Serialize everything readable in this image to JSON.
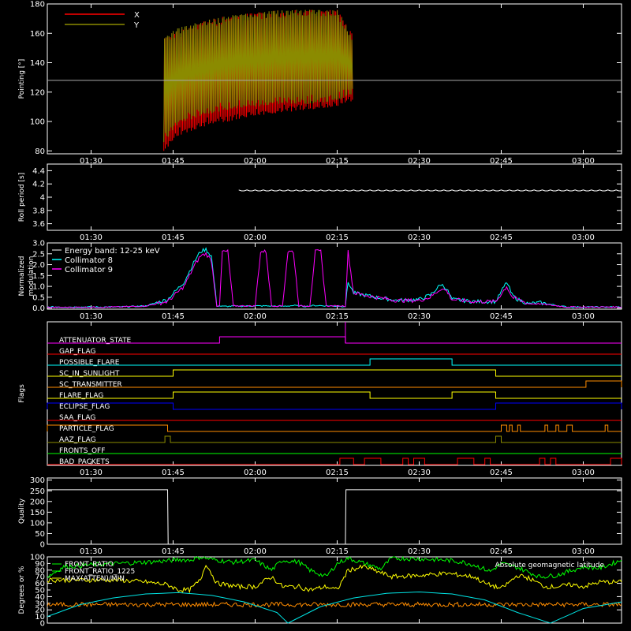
{
  "time_axis": {
    "ticks": [
      "01:30",
      "01:45",
      "02:00",
      "02:15",
      "02:30",
      "02:45",
      "03:00"
    ],
    "tick_values_min": [
      90,
      105,
      120,
      135,
      150,
      165,
      180
    ],
    "range_min": [
      82,
      187
    ]
  },
  "colors": {
    "x": "#ff0000",
    "y": "#8b8b00",
    "cyan": "#00ffff",
    "magenta": "#ff00ff",
    "yellow": "#ffff00",
    "green": "#00ff00",
    "orange": "#ff8c00",
    "red": "#ff0000",
    "blue": "#0000ff",
    "pink": "#ff1493"
  },
  "chart_data": [
    {
      "id": "pointing",
      "type": "line",
      "ylabel": "Pointing [°]",
      "ylim": [
        78,
        180
      ],
      "yticks": [
        80,
        100,
        120,
        140,
        160,
        180
      ],
      "legend": [
        "X",
        "Y"
      ],
      "series": [
        {
          "name": "X",
          "color": "#ff0000",
          "segments": [
            {
              "x": [
                103.3,
                106,
                110,
                115,
                120,
                125,
                130,
                135,
                137.8
              ],
              "lo": [
                80,
                90,
                96,
                100,
                104,
                106,
                108,
                110,
                114
              ],
              "hi": [
                158,
                162,
                168,
                172,
                174,
                176,
                176,
                176,
                160
              ]
            }
          ]
        },
        {
          "name": "Y",
          "color": "#8b8b00",
          "segments": [
            {
              "x": [
                103.3,
                106,
                110,
                115,
                120,
                125,
                130,
                135,
                137.8
              ],
              "lo": [
                86,
                98,
                104,
                108,
                110,
                112,
                112,
                114,
                118
              ],
              "hi": [
                158,
                164,
                168,
                172,
                174,
                176,
                176,
                176,
                158
              ]
            }
          ]
        }
      ],
      "reference_line": 128
    },
    {
      "id": "roll",
      "type": "line",
      "ylabel": "Roll period [s]",
      "ylim": [
        3.5,
        4.5
      ],
      "yticks": [
        3.6,
        3.8,
        4.0,
        4.2,
        4.4
      ],
      "series": [
        {
          "name": "",
          "color": "#ffffff",
          "x": [
            82,
            187
          ],
          "y": [
            4.1,
            4.1
          ]
        }
      ]
    },
    {
      "id": "modulation",
      "type": "line",
      "ylabel": "Normalized modulation",
      "ylim": [
        -0.05,
        3.0
      ],
      "yticks": [
        "0.0",
        "0.5",
        "1.0",
        "1.5",
        "2.0",
        "2.5",
        "3.0"
      ],
      "legend_title": "Energy band: 12-25 keV",
      "series": [
        {
          "name": "Collimator 8",
          "color": "#00ffff",
          "x": [
            82,
            95,
            100,
            104,
            107,
            109,
            110,
            111,
            112,
            113,
            113.5,
            114,
            120,
            121,
            122,
            125,
            126,
            127,
            129,
            130,
            131,
            136.5,
            137,
            138,
            142,
            146,
            150,
            152,
            154,
            155,
            156,
            160,
            164,
            166,
            167,
            168,
            170,
            172,
            177,
            187
          ],
          "y": [
            0.05,
            0.05,
            0.1,
            0.4,
            1.2,
            2.2,
            2.6,
            2.7,
            2.4,
            0.1,
            0.1,
            0.08,
            0.1,
            0.1,
            0.1,
            0.08,
            0.1,
            0.12,
            0.08,
            0.1,
            0.12,
            0.08,
            1.2,
            0.7,
            0.5,
            0.35,
            0.4,
            0.6,
            1.1,
            0.9,
            0.4,
            0.3,
            0.3,
            1.2,
            0.6,
            0.4,
            0.2,
            0.25,
            0.05,
            0.05
          ]
        },
        {
          "name": "Collimator 9",
          "color": "#ff00ff",
          "x": [
            82,
            95,
            100,
            104,
            107,
            109,
            110,
            111,
            112,
            113,
            113.5,
            114,
            115,
            116,
            117,
            118,
            120,
            121,
            122,
            123,
            124,
            125,
            126,
            127,
            128,
            129,
            130,
            131,
            132,
            133,
            134,
            135,
            136,
            136.5,
            137,
            138,
            142,
            146,
            150,
            152,
            154,
            155,
            156,
            160,
            164,
            166,
            167,
            168,
            170,
            172,
            177,
            187
          ],
          "y": [
            0.03,
            0.05,
            0.1,
            0.3,
            1.0,
            2.0,
            2.4,
            2.5,
            2.2,
            0.1,
            0.1,
            2.6,
            2.6,
            0.1,
            0.1,
            0.1,
            0.1,
            2.6,
            2.6,
            0.1,
            0.1,
            0.1,
            2.6,
            2.6,
            0.1,
            0.1,
            0.1,
            2.6,
            2.6,
            0.1,
            0.1,
            0.1,
            0.1,
            0.1,
            2.6,
            0.7,
            0.5,
            0.35,
            0.35,
            0.5,
            0.9,
            0.8,
            0.4,
            0.3,
            0.3,
            1.0,
            0.5,
            0.4,
            0.2,
            0.2,
            0.05,
            0.05
          ]
        }
      ]
    },
    {
      "id": "flags",
      "type": "step",
      "ylabel": "Flags",
      "flags": [
        {
          "name": "ATTENUATOR_STATE",
          "color": "#ff00ff",
          "on": [
            [
              113.5,
              136.5
            ]
          ],
          "spike": 136.5
        },
        {
          "name": "GAP_FLAG",
          "color": "#ff0000",
          "on": []
        },
        {
          "name": "POSSIBLE_FLARE",
          "color": "#00ffff",
          "on": [
            [
              141,
              156
            ]
          ]
        },
        {
          "name": "SC_IN_SUNLIGHT",
          "color": "#ffff00",
          "on": [
            [
              105,
              164
            ]
          ]
        },
        {
          "name": "SC_TRANSMITTER",
          "color": "#ff8c00",
          "on": [
            [
              180.5,
              187
            ]
          ]
        },
        {
          "name": "FLARE_FLAG",
          "color": "#ffff00",
          "on": [
            [
              105,
              141
            ],
            [
              156,
              164
            ]
          ]
        },
        {
          "name": "ECLIPSE_FLAG",
          "color": "#0000ff",
          "on": [
            [
              82,
              105
            ],
            [
              164,
              187
            ]
          ]
        },
        {
          "name": "SAA_FLAG",
          "color": "#ff0000",
          "on": []
        },
        {
          "name": "PARTICLE_FLAG",
          "color": "#ff8c00",
          "on": [
            [
              82,
              104
            ],
            [
              165,
              166
            ],
            [
              166.5,
              167
            ],
            [
              168,
              168.5
            ],
            [
              173,
              173.5
            ],
            [
              175,
              175.5
            ],
            [
              177,
              178
            ],
            [
              184,
              184.5
            ]
          ]
        },
        {
          "name": "AAZ_FLAG",
          "color": "#8b8b00",
          "on": [
            [
              103.5,
              104.5
            ],
            [
              164,
              165
            ]
          ]
        },
        {
          "name": "FRONTS_OFF",
          "color": "#00ff00",
          "on": []
        },
        {
          "name": "BAD_PACKETS",
          "color": "#ff0000",
          "on": [
            [
              135.5,
              138
            ],
            [
              140,
              143
            ],
            [
              147,
              148
            ],
            [
              149,
              151
            ],
            [
              157,
              160
            ],
            [
              162,
              163
            ],
            [
              172,
              173
            ],
            [
              174,
              175
            ],
            [
              185,
              187
            ]
          ]
        }
      ]
    },
    {
      "id": "quality",
      "type": "line",
      "ylabel": "Quality",
      "ylim": [
        0,
        310
      ],
      "yticks": [
        0,
        50,
        100,
        150,
        200,
        250,
        300
      ],
      "series": [
        {
          "name": "",
          "color": "#ffffff",
          "x": [
            82,
            104,
            104.1,
            136.5,
            136.6,
            187
          ],
          "y": [
            255,
            255,
            0,
            0,
            255,
            255
          ]
        }
      ]
    },
    {
      "id": "ratios",
      "type": "line",
      "ylabel": "Degrees or %",
      "ylim": [
        0,
        100
      ],
      "yticks": [
        0,
        10,
        20,
        30,
        40,
        50,
        60,
        70,
        80,
        90,
        100
      ],
      "legend": [
        "FRONT_RATIO",
        "FRONT_RATIO_1225",
        "MAX(ATTEN)/MIN",
        "Absolute geomagnetic latitude"
      ],
      "series": [
        {
          "name": "FRONT_RATIO",
          "color": "#00ff00",
          "x": [
            82,
            85,
            90,
            95,
            100,
            104,
            106,
            108,
            110,
            111,
            113,
            116,
            120,
            123,
            125,
            128,
            130,
            133,
            135,
            137,
            140,
            143,
            145,
            150,
            155,
            158,
            160,
            163,
            165,
            168,
            172,
            175,
            180,
            183,
            187
          ],
          "y": [
            70,
            85,
            88,
            90,
            92,
            94,
            96,
            95,
            100,
            98,
            95,
            92,
            95,
            80,
            95,
            92,
            80,
            70,
            90,
            98,
            90,
            82,
            98,
            97,
            95,
            92,
            88,
            78,
            90,
            84,
            70,
            72,
            85,
            83,
            95
          ]
        },
        {
          "name": "FRONT_RATIO_1225",
          "color": "#00ff00",
          "x": [
            82,
            187
          ],
          "y": [
            95,
            95
          ]
        },
        {
          "name": "MAX(ATTEN)/MIN",
          "color": "#ffff00",
          "x": [
            82,
            95,
            100,
            104,
            106,
            108,
            110,
            111,
            113,
            117,
            120,
            123,
            125,
            128,
            130,
            133,
            135,
            137,
            140,
            145,
            150,
            155,
            158,
            160,
            162,
            165,
            168,
            170,
            173,
            175,
            178,
            180,
            183,
            187
          ],
          "y": [
            65,
            65,
            62,
            58,
            50,
            50,
            65,
            90,
            60,
            55,
            55,
            70,
            55,
            55,
            50,
            55,
            50,
            80,
            85,
            70,
            72,
            75,
            72,
            70,
            60,
            52,
            72,
            68,
            55,
            55,
            58,
            55,
            62,
            62
          ]
        },
        {
          "name": "",
          "color": "#ff8c00",
          "x": [
            82,
            187
          ],
          "y": [
            28,
            28
          ]
        },
        {
          "name": "Absolute geomagnetic latitude",
          "color": "#00e5e5",
          "x": [
            82,
            88,
            94,
            100,
            106,
            112,
            118,
            124,
            126,
            132,
            138,
            144,
            150,
            156,
            162,
            168,
            174,
            180,
            187
          ],
          "y": [
            10,
            28,
            38,
            44,
            46,
            42,
            32,
            16,
            0,
            25,
            38,
            45,
            47,
            44,
            35,
            16,
            0,
            22,
            32
          ]
        }
      ]
    }
  ]
}
